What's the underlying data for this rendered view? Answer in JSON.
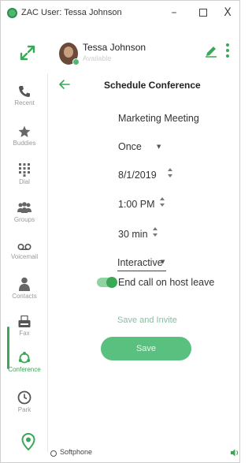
{
  "window": {
    "title": "ZAC User: Tessa Johnson",
    "minimize": "–",
    "close": "X"
  },
  "user": {
    "name": "Tessa Johnson",
    "status": "Available"
  },
  "sidebar": {
    "items": [
      {
        "label": "Recent",
        "icon": "phone-icon"
      },
      {
        "label": "Buddies",
        "icon": "star-icon"
      },
      {
        "label": "Dial",
        "icon": "dialpad-icon"
      },
      {
        "label": "Groups",
        "icon": "groups-icon"
      },
      {
        "label": "Voicemail",
        "icon": "voicemail-icon"
      },
      {
        "label": "Contacts",
        "icon": "contacts-icon"
      },
      {
        "label": "Fax",
        "icon": "fax-icon"
      },
      {
        "label": "Conference",
        "icon": "conference-icon"
      },
      {
        "label": "Park",
        "icon": "park-icon"
      }
    ],
    "active": "Conference"
  },
  "form": {
    "title": "Schedule Conference",
    "name_value": "Marketing Meeting",
    "recurrence_value": "Once",
    "date_value": "8/1/2019",
    "time_value": "1:00 PM",
    "duration_value": "30 min",
    "mode_value": "Interactive",
    "end_on_host_leave_label": "End call on host leave",
    "end_on_host_leave": true,
    "save_and_invite_label": "Save and Invite",
    "save_label": "Save"
  },
  "footer": {
    "softphone_label": "Softphone"
  },
  "colors": {
    "accent": "#3aa856",
    "accent_light": "#5ac07f"
  }
}
